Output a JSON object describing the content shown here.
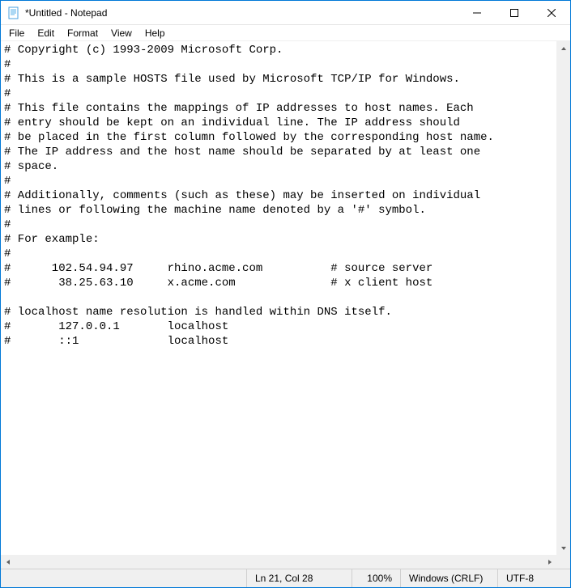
{
  "window": {
    "title": "*Untitled - Notepad"
  },
  "menu": {
    "file": "File",
    "edit": "Edit",
    "format": "Format",
    "view": "View",
    "help": "Help"
  },
  "editor": {
    "content": "# Copyright (c) 1993-2009 Microsoft Corp.\n#\n# This is a sample HOSTS file used by Microsoft TCP/IP for Windows.\n#\n# This file contains the mappings of IP addresses to host names. Each\n# entry should be kept on an individual line. The IP address should\n# be placed in the first column followed by the corresponding host name.\n# The IP address and the host name should be separated by at least one\n# space.\n#\n# Additionally, comments (such as these) may be inserted on individual\n# lines or following the machine name denoted by a '#' symbol.\n#\n# For example:\n#\n#      102.54.94.97     rhino.acme.com          # source server\n#       38.25.63.10     x.acme.com              # x client host\n\n# localhost name resolution is handled within DNS itself.\n#\t127.0.0.1       localhost\n#\t::1             localhost"
  },
  "statusbar": {
    "position": "Ln 21, Col 28",
    "zoom": "100%",
    "eol": "Windows (CRLF)",
    "encoding": "UTF-8"
  }
}
